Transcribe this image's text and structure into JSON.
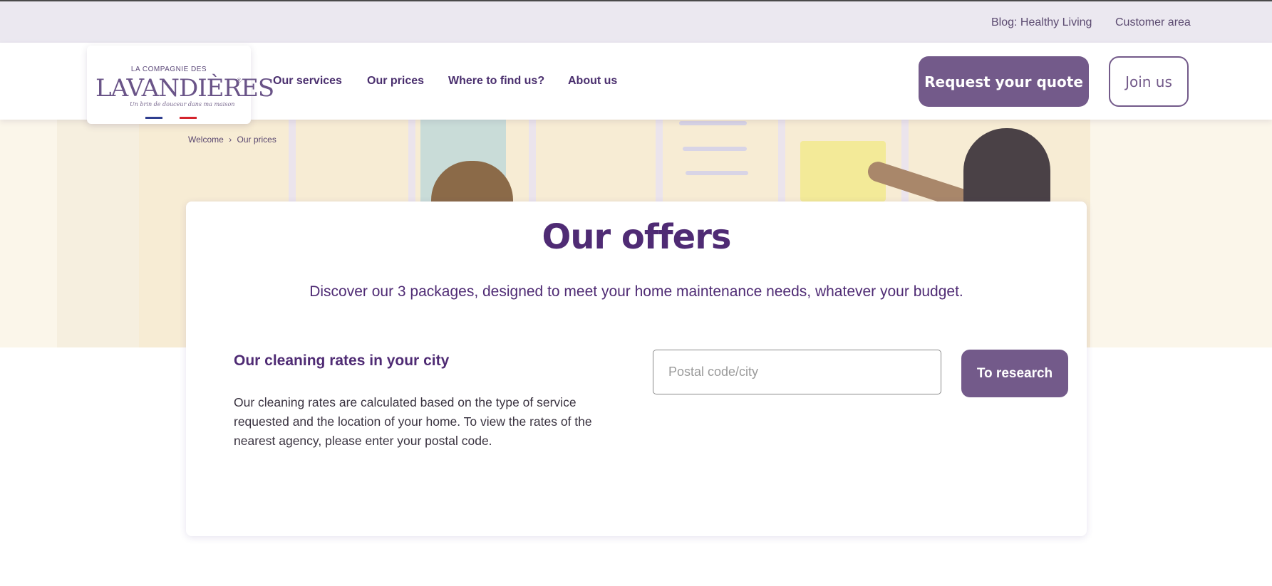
{
  "topbar": {
    "blog_link": "Blog: Healthy Living",
    "customer_area_link": "Customer area"
  },
  "logo": {
    "small_text": "LA COMPAGNIE DES",
    "main_text": "LAVANDIÈRES",
    "registered_mark": "®",
    "tagline": "Un brin de douceur dans ma maison"
  },
  "nav": {
    "items": [
      {
        "label": "Our services"
      },
      {
        "label": "Our prices"
      },
      {
        "label": "Where to find us?"
      },
      {
        "label": "About us"
      }
    ],
    "quote_button": "Request your quote",
    "join_button": "Join us"
  },
  "breadcrumb": {
    "home": "Welcome",
    "separator": "›",
    "current": "Our prices"
  },
  "offers": {
    "title": "Our offers",
    "subtitle": "Discover our 3 packages, designed to meet your home maintenance needs, whatever your budget.",
    "rates_heading": "Our cleaning rates in your city",
    "rates_description": "Our cleaning rates are calculated based on the type of service requested and the location of your home. To view the rates of the nearest agency, please enter your postal code.",
    "search_placeholder": "Postal code/city",
    "search_value": "",
    "search_button": "To research"
  },
  "colors": {
    "brand_purple": "#735a8a",
    "heading_purple": "#4f2b74",
    "topbar_bg": "#ebe8f0"
  }
}
